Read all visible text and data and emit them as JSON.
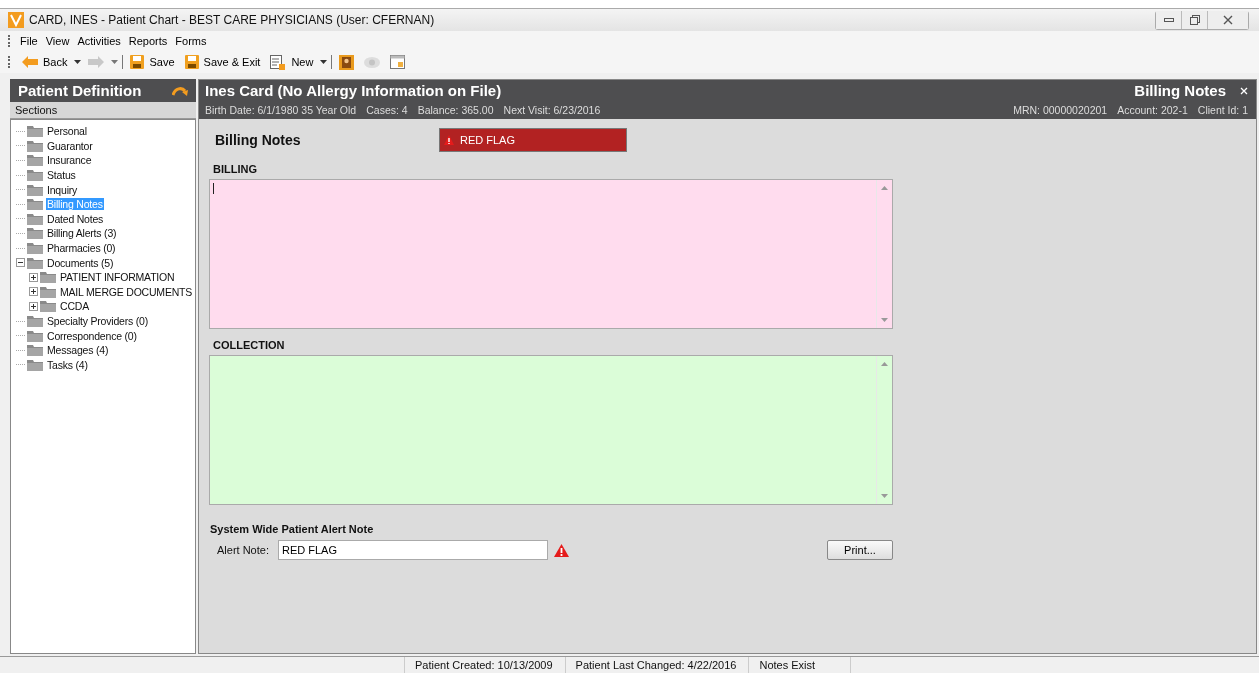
{
  "window": {
    "title": "CARD, INES - Patient Chart - BEST CARE PHYSICIANS (User: CFERNAN)"
  },
  "menu": [
    "File",
    "View",
    "Activities",
    "Reports",
    "Forms"
  ],
  "toolbar": [
    {
      "kind": "back",
      "label": "Back",
      "disabled": false
    },
    {
      "kind": "forward",
      "disabled": true
    },
    {
      "kind": "save",
      "label": "Save",
      "disabled": false
    },
    {
      "kind": "save",
      "label": "Save & Exit",
      "disabled": false
    },
    {
      "kind": "new",
      "label": "New",
      "disabled": false
    },
    {
      "kind": "photo",
      "disabled": false
    },
    {
      "kind": "eye",
      "disabled": true
    },
    {
      "kind": "calendar",
      "disabled": false
    }
  ],
  "sidebar": {
    "title": "Patient Definition",
    "subtitle": "Sections",
    "items": [
      {
        "label": "Personal",
        "selected": false
      },
      {
        "label": "Guarantor",
        "selected": false
      },
      {
        "label": "Insurance",
        "selected": false
      },
      {
        "label": "Status",
        "selected": false
      },
      {
        "label": "Inquiry",
        "selected": false
      },
      {
        "label": "Billing Notes",
        "selected": true
      },
      {
        "label": "Dated Notes",
        "selected": false
      },
      {
        "label": "Billing Alerts (3)",
        "selected": false
      },
      {
        "label": "Pharmacies (0)",
        "selected": false
      },
      {
        "label": "Documents (5)",
        "selected": false,
        "expanded": true,
        "children": [
          {
            "label": "PATIENT INFORMATION",
            "selected": false,
            "expanded": false
          },
          {
            "label": "MAIL MERGE DOCUMENTS",
            "selected": false,
            "expanded": false
          },
          {
            "label": "CCDA",
            "selected": false,
            "expanded": false
          }
        ]
      },
      {
        "label": "Specialty Providers (0)",
        "selected": false
      },
      {
        "label": "Correspondence (0)",
        "selected": false
      },
      {
        "label": "Messages (4)",
        "selected": false
      },
      {
        "label": "Tasks (4)",
        "selected": false
      }
    ]
  },
  "header": {
    "title": "Ines Card (No Allergy Information on File)",
    "section": "Billing Notes",
    "info": [
      "Birth Date: 6/1/1980 35 Year Old",
      "Cases: 4",
      "Balance: 365.00",
      "Next Visit: 6/23/2016"
    ],
    "ids": [
      "MRN: 00000020201",
      "Account: 202-1",
      "Client Id: 1"
    ]
  },
  "content": {
    "title": "Billing Notes",
    "alert_banner": "RED FLAG",
    "notes": [
      {
        "label": "BILLING",
        "color": "#ffdcee"
      },
      {
        "label": "COLLECTION",
        "color": "#dbfdd8"
      }
    ],
    "alert_section": "System Wide Patient Alert Note",
    "alert_label": "Alert Note:",
    "alert_value": "RED FLAG",
    "print_button": "Print..."
  },
  "status_bar": [
    "Patient Created: 10/13/2009",
    "Patient Last Changed: 4/22/2016",
    "Notes Exist"
  ]
}
